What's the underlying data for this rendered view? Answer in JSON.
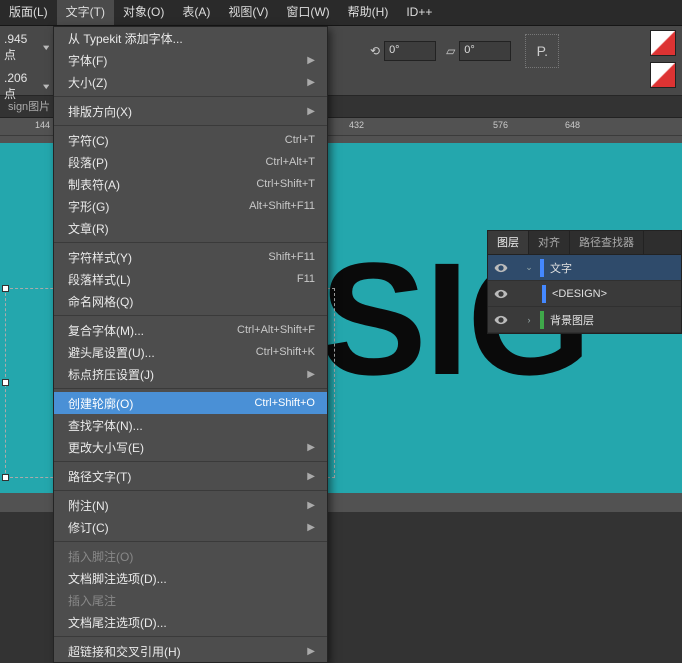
{
  "menubar": {
    "items": [
      {
        "label": "版面(L)"
      },
      {
        "label": "文字(T)"
      },
      {
        "label": "对象(O)"
      },
      {
        "label": "表(A)"
      },
      {
        "label": "视图(V)"
      },
      {
        "label": "窗口(W)"
      },
      {
        "label": "帮助(H)"
      },
      {
        "label": "ID++"
      }
    ],
    "active": 1
  },
  "optbar": {
    "val1": ".945 点",
    "val2": ".206 点",
    "angle": "0°"
  },
  "document": {
    "tab_label": "sign图片"
  },
  "ruler": {
    "marks": [
      {
        "pos": 35,
        "label": "144"
      },
      {
        "pos": 349,
        "label": "432"
      },
      {
        "pos": 422,
        "label": ""
      },
      {
        "pos": 493,
        "label": "576"
      },
      {
        "pos": 565,
        "label": "648"
      }
    ]
  },
  "canvas": {
    "big_text": "SIG"
  },
  "dropdown": {
    "items": [
      {
        "label": "从 Typekit 添加字体...",
        "shortcut": "",
        "sub": false
      },
      {
        "label": "字体(F)",
        "shortcut": "",
        "sub": true
      },
      {
        "label": "大小(Z)",
        "shortcut": "",
        "sub": true
      },
      {
        "sep": true
      },
      {
        "label": "排版方向(X)",
        "shortcut": "",
        "sub": true
      },
      {
        "sep": true
      },
      {
        "label": "字符(C)",
        "shortcut": "Ctrl+T",
        "sub": false
      },
      {
        "label": "段落(P)",
        "shortcut": "Ctrl+Alt+T",
        "sub": false
      },
      {
        "label": "制表符(A)",
        "shortcut": "Ctrl+Shift+T",
        "sub": false
      },
      {
        "label": "字形(G)",
        "shortcut": "Alt+Shift+F11",
        "sub": false
      },
      {
        "label": "文章(R)",
        "shortcut": "",
        "sub": false
      },
      {
        "sep": true
      },
      {
        "label": "字符样式(Y)",
        "shortcut": "Shift+F11",
        "sub": false
      },
      {
        "label": "段落样式(L)",
        "shortcut": "F11",
        "sub": false
      },
      {
        "label": "命名网格(Q)",
        "shortcut": "",
        "sub": false
      },
      {
        "sep": true
      },
      {
        "label": "复合字体(M)...",
        "shortcut": "Ctrl+Alt+Shift+F",
        "sub": false
      },
      {
        "label": "避头尾设置(U)...",
        "shortcut": "Ctrl+Shift+K",
        "sub": false
      },
      {
        "label": "标点挤压设置(J)",
        "shortcut": "",
        "sub": true
      },
      {
        "sep": true
      },
      {
        "label": "创建轮廓(O)",
        "shortcut": "Ctrl+Shift+O",
        "sub": false,
        "hl": true
      },
      {
        "label": "查找字体(N)...",
        "shortcut": "",
        "sub": false
      },
      {
        "label": "更改大小写(E)",
        "shortcut": "",
        "sub": true
      },
      {
        "sep": true
      },
      {
        "label": "路径文字(T)",
        "shortcut": "",
        "sub": true
      },
      {
        "sep": true
      },
      {
        "label": "附注(N)",
        "shortcut": "",
        "sub": true
      },
      {
        "label": "修订(C)",
        "shortcut": "",
        "sub": true
      },
      {
        "sep": true
      },
      {
        "label": "插入脚注(O)",
        "shortcut": "",
        "sub": false,
        "disabled": true
      },
      {
        "label": "文档脚注选项(D)...",
        "shortcut": "",
        "sub": false
      },
      {
        "label": "插入尾注",
        "shortcut": "",
        "sub": false,
        "disabled": true
      },
      {
        "label": "文档尾注选项(D)...",
        "shortcut": "",
        "sub": false
      },
      {
        "sep": true
      },
      {
        "label": "超链接和交叉引用(H)",
        "shortcut": "",
        "sub": true
      }
    ]
  },
  "panel": {
    "tabs": [
      {
        "label": "图层"
      },
      {
        "label": "对齐"
      },
      {
        "label": "路径查找器"
      }
    ],
    "active_tab": 0,
    "layers": [
      {
        "name": "文字",
        "color": "#4488ff",
        "expanded": true,
        "selected": true,
        "eye": true,
        "arrow": "v"
      },
      {
        "name": "<DESIGN>",
        "color": "#4488ff",
        "indent": true,
        "eye": true
      },
      {
        "name": "背景图层",
        "color": "#3fa84a",
        "eye": true,
        "arrow": ">"
      }
    ]
  }
}
